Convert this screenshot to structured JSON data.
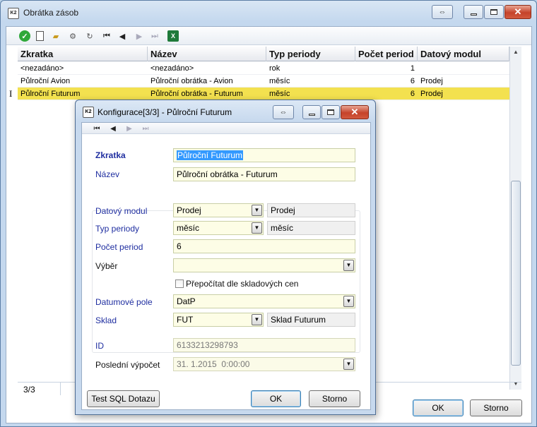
{
  "window": {
    "title": "Obrátka zásob",
    "icon_text": "K2",
    "ok_label": "OK",
    "cancel_label": "Storno"
  },
  "toolbar": {
    "icons": [
      "check-icon",
      "new-document-icon",
      "open-folder-icon",
      "settings-icon",
      "refresh-icon",
      "first-record-icon",
      "previous-record-icon",
      "next-record-icon",
      "last-record-icon",
      "excel-export-icon"
    ]
  },
  "grid": {
    "columns": [
      "Zkratka",
      "Název",
      "Typ periody",
      "Počet period",
      "Datový modul"
    ],
    "rows": [
      {
        "zkratka": "<nezadáno>",
        "nazev": "<nezadáno>",
        "typ": "rok",
        "pocet": "1",
        "modul": ""
      },
      {
        "zkratka": "Půlroční Avion",
        "nazev": "Půlroční obrátka - Avion",
        "typ": "měsíc",
        "pocet": "6",
        "modul": "Prodej"
      },
      {
        "zkratka": "Půlroční Futurum",
        "nazev": "Půlroční obrátka - Futurum",
        "typ": "měsíc",
        "pocet": "6",
        "modul": "Prodej"
      }
    ],
    "selected_index": 2,
    "row_indicator": "I"
  },
  "status": {
    "record": "3/3"
  },
  "dialog": {
    "title": "Konfigurace[3/3] - Půlroční Futurum",
    "icon_text": "K2",
    "fields": {
      "zkratka_label": "Zkratka",
      "zkratka_value": "Půlroční Futurum",
      "nazev_label": "Název",
      "nazev_value": "Půlroční obrátka - Futurum",
      "modul_label": "Datový modul",
      "modul_value": "Prodej",
      "modul_display": "Prodej",
      "typ_label": "Typ periody",
      "typ_value": "měsíc",
      "typ_display": "měsíc",
      "pocet_label": "Počet period",
      "pocet_value": "6",
      "vyber_label": "Výběr",
      "vyber_value": "",
      "prepocitat_label": "Přepočítat dle skladových cen",
      "prepocitat_checked": false,
      "datum_label": "Datumové pole",
      "datum_value": "DatP",
      "sklad_label": "Sklad",
      "sklad_value": "FUT",
      "sklad_display": "Sklad Futurum",
      "id_label": "ID",
      "id_value": "6133213298793",
      "posledni_label": "Poslední výpočet",
      "posledni_value": "31. 1.2015  0:00:00"
    },
    "test_sql_label": "Test SQL Dotazu",
    "ok_label": "OK",
    "cancel_label": "Storno"
  }
}
